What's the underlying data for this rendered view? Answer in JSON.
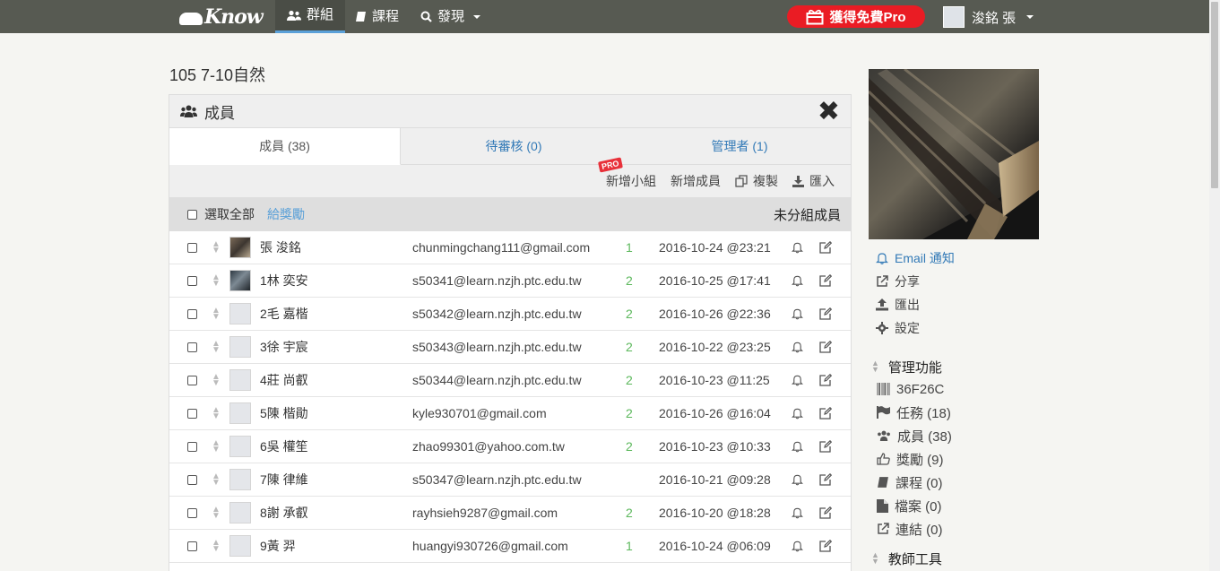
{
  "nav": {
    "logo": "Know",
    "groups": "群組",
    "courses": "課程",
    "discover": "發現",
    "pro_button": "獲得免費Pro",
    "user_name": "浚銘 張"
  },
  "group_title": "105 7-10自然",
  "panel": {
    "title": "成員",
    "tabs": [
      "成員 (38)",
      "待審核 (0)",
      "管理者 (1)"
    ],
    "pro_badge": "PRO",
    "toolbar": {
      "add_group": "新增小組",
      "add_member": "新增成員",
      "copy": "複製",
      "import": "匯入"
    },
    "select_all": "選取全部",
    "give_award": "給獎勵",
    "ungrouped": "未分組成員"
  },
  "members": [
    {
      "name": "張 浚銘",
      "email": "chunmingchang111@gmail.com",
      "count": "1",
      "date": "2016-10-24 @23:21",
      "avatar": "photo1"
    },
    {
      "name": "1林 奕安",
      "email": "s50341@learn.nzjh.ptc.edu.tw",
      "count": "2",
      "date": "2016-10-25 @17:41",
      "avatar": "photo2"
    },
    {
      "name": "2毛 嘉楷",
      "email": "s50342@learn.nzjh.ptc.edu.tw",
      "count": "2",
      "date": "2016-10-26 @22:36",
      "avatar": "default"
    },
    {
      "name": "3徐 宇宸",
      "email": "s50343@learn.nzjh.ptc.edu.tw",
      "count": "2",
      "date": "2016-10-22 @23:25",
      "avatar": "default"
    },
    {
      "name": "4莊 尚叡",
      "email": "s50344@learn.nzjh.ptc.edu.tw",
      "count": "2",
      "date": "2016-10-23 @11:25",
      "avatar": "default"
    },
    {
      "name": "5陳 楷勛",
      "email": "kyle930701@gmail.com",
      "count": "2",
      "date": "2016-10-26 @16:04",
      "avatar": "default"
    },
    {
      "name": "6吳 權笙",
      "email": "zhao99301@yahoo.com.tw",
      "count": "2",
      "date": "2016-10-23 @10:33",
      "avatar": "default"
    },
    {
      "name": "7陳 律維",
      "email": "s50347@learn.nzjh.ptc.edu.tw",
      "count": "",
      "date": "2016-10-21 @09:28",
      "avatar": "default"
    },
    {
      "name": "8謝 承叡",
      "email": "rayhsieh9287@gmail.com",
      "count": "2",
      "date": "2016-10-20 @18:28",
      "avatar": "default"
    },
    {
      "name": "9黃 羿",
      "email": "huangyi930726@gmail.com",
      "count": "1",
      "date": "2016-10-24 @06:09",
      "avatar": "default"
    }
  ],
  "sidebar": {
    "email_notify": "Email 通知",
    "share": "分享",
    "export": "匯出",
    "settings": "設定",
    "admin_title": "管理功能",
    "admin_items": [
      "36F26C",
      "任務 (18)",
      "成員 (38)",
      "獎勵 (9)",
      "課程 (0)",
      "檔案 (0)",
      "連結 (0)"
    ],
    "teacher_tools": "教師工具"
  }
}
